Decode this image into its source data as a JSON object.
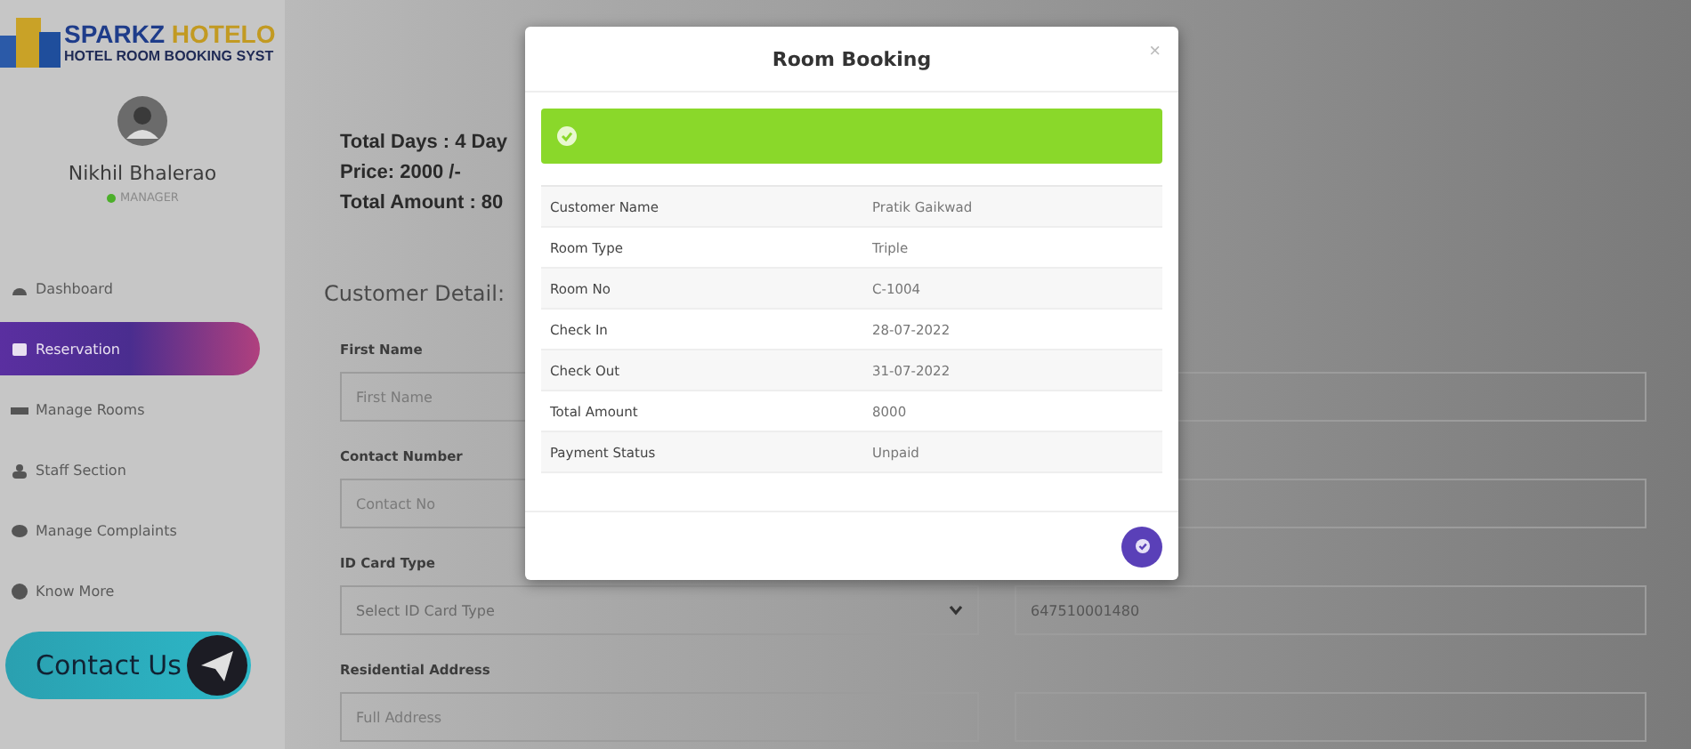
{
  "brand": {
    "name_first": "SPARKZ",
    "name_second": "HOTELO",
    "tagline": "HOTEL ROOM BOOKING SYST"
  },
  "user": {
    "name": "Nikhil Bhalerao",
    "role": "MANAGER"
  },
  "nav": [
    {
      "label": "Dashboard",
      "selected": false
    },
    {
      "label": "Reservation",
      "selected": true
    },
    {
      "label": "Manage Rooms",
      "selected": false
    },
    {
      "label": "Staff Section",
      "selected": false
    },
    {
      "label": "Manage Complaints",
      "selected": false
    },
    {
      "label": "Know More",
      "selected": false
    }
  ],
  "contact_button": {
    "label": "Contact Us"
  },
  "summary": [
    "Total Days : 4 Day",
    "Price: 2000 /-",
    "Total Amount : 80"
  ],
  "section_title": "Customer Detail:",
  "left_fields": [
    {
      "label": "First Name",
      "placeholder": "First Name",
      "kind": "input"
    },
    {
      "label": "Contact Number",
      "placeholder": "Contact No",
      "kind": "input"
    },
    {
      "label": "ID Card Type",
      "placeholder": "Select ID Card Type",
      "kind": "select"
    },
    {
      "label": "Residential Address",
      "placeholder": "Full Address",
      "kind": "input"
    }
  ],
  "id_number_field": {
    "value": "647510001480"
  },
  "modal": {
    "title": "Room Booking",
    "close": "×",
    "rows": [
      {
        "label": "Customer Name",
        "value": "Pratik Gaikwad"
      },
      {
        "label": "Room Type",
        "value": "Triple"
      },
      {
        "label": "Room No",
        "value": "C-1004"
      },
      {
        "label": "Check In",
        "value": "28-07-2022"
      },
      {
        "label": "Check Out",
        "value": "31-07-2022"
      },
      {
        "label": "Total Amount",
        "value": "8000"
      },
      {
        "label": "Payment Status",
        "value": "Unpaid"
      }
    ]
  }
}
